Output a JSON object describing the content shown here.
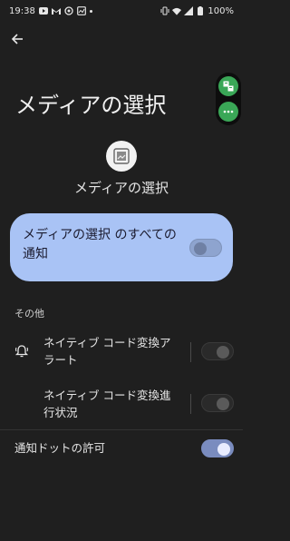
{
  "status_bar": {
    "time": "19:38",
    "battery": "100%",
    "left_icons": [
      "youtube-icon",
      "gmail-icon",
      "whatsapp-icon",
      "image-icon",
      "dot-icon"
    ],
    "right_icons": [
      "vibrate-icon",
      "wifi-icon",
      "signal-icon",
      "battery-icon"
    ]
  },
  "header": {
    "back_icon": "arrow-back-icon",
    "title": "メディアの選択"
  },
  "floating_bubble": {
    "icons": [
      "translate-icon",
      "more-icon"
    ],
    "accent": "#3aa757"
  },
  "app": {
    "icon": "image-picker-icon",
    "name": "メディアの選択"
  },
  "all_notifications": {
    "label": "メディアの選択 のすべての通知",
    "enabled": false,
    "card_color": "#a9c3f5"
  },
  "other_section": {
    "title": "その他",
    "items": [
      {
        "icon": "bell-icon",
        "label": "ネイティブ コード変換アラート",
        "enabled": false
      },
      {
        "icon": "",
        "label": "ネイティブ コード変換進行状況",
        "enabled": false
      }
    ]
  },
  "notification_dot": {
    "label": "通知ドットの許可",
    "enabled": true
  }
}
